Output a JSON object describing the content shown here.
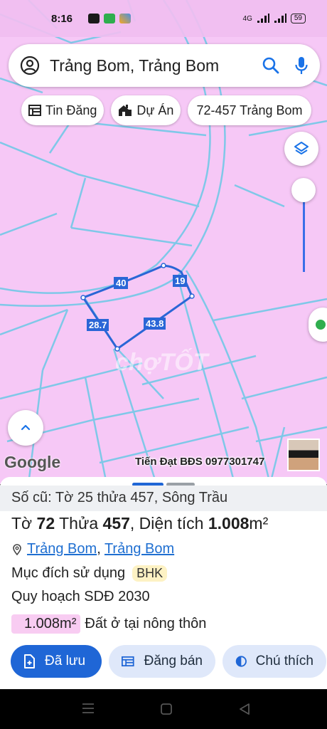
{
  "status_bar": {
    "time": "8:16",
    "network": "4G",
    "battery": "59",
    "app_icons": [
      "zalo-icon",
      "messages-icon",
      "photos-icon"
    ]
  },
  "search": {
    "query": "Trảng Bom, Trảng Bom"
  },
  "chips": [
    {
      "label": "Tin Đăng",
      "icon": "table-icon"
    },
    {
      "label": "Dự Án",
      "icon": "building-icon"
    },
    {
      "label": "72-457 Trảng Bom"
    }
  ],
  "map": {
    "parcel_dimensions": {
      "top_left": "40",
      "top_right": "19",
      "left": "28.7",
      "right": "43.8"
    },
    "watermark": "chợTỐT",
    "google_logo": "Google",
    "agent": "Tiến Đạt BĐS 0977301747",
    "zoom_level": 0.0
  },
  "sheet": {
    "old_info": "Số cũ: Tờ 25 thửa 457, Sông Trầu",
    "title": {
      "to_label": "Tờ ",
      "to_value": "72",
      "thua_label": " Thửa ",
      "thua_value": "457",
      "area_label": ", Diện tích ",
      "area_value": "1.008",
      "area_unit": "m²"
    },
    "location": {
      "district": "Trảng Bom",
      "separator": ", ",
      "town": "Trảng Bom"
    },
    "purpose_label": "Mục đích sử dụng",
    "purpose_code": "BHK",
    "plan_label": "Quy hoạch SDĐ 2030",
    "plan_area": "1.008m²",
    "plan_type": "Đất ở tại nông thôn",
    "buttons": {
      "saved": "Đã lưu",
      "post_sale": "Đăng bán",
      "legend": "Chú thích"
    }
  },
  "colors": {
    "map_bg": "#f6c8f6",
    "lot_lines": "#7fc8e8",
    "accent": "#1f66d6"
  }
}
